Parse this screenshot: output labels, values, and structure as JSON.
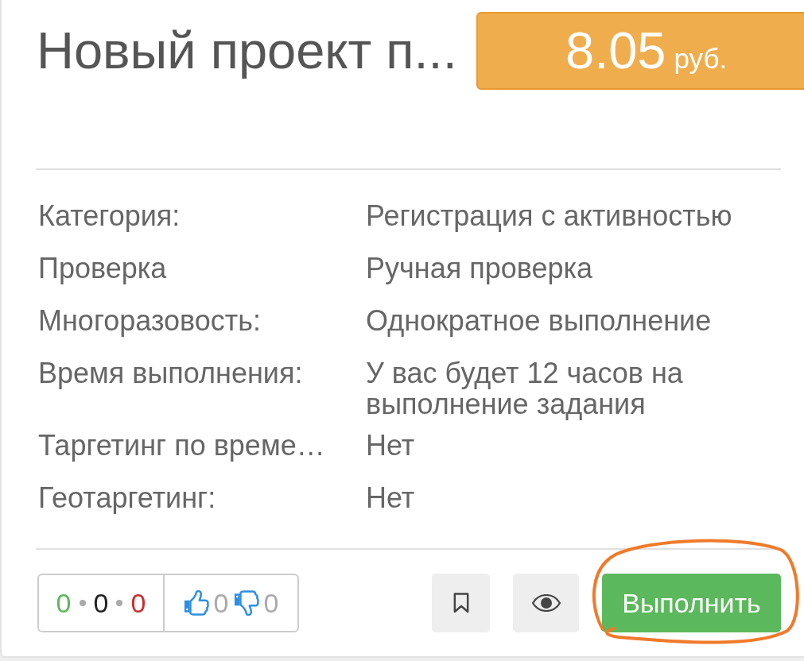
{
  "task": {
    "title": "Новый проект п...",
    "price": {
      "amount": "8.05",
      "currency": "руб."
    }
  },
  "details": [
    {
      "label": "Категория:",
      "value": "Регистрация с активностью"
    },
    {
      "label": "Проверка",
      "value": "Ручная проверка"
    },
    {
      "label": "Многоразовость:",
      "value": "Однократное выполнение"
    },
    {
      "label": "Время выполнения:",
      "value": "У вас будет 12 часов на выполнение задания"
    },
    {
      "label": "Таргетинг по време…",
      "value": "Нет"
    },
    {
      "label": "Геотаргетинг:",
      "value": "Нет"
    }
  ],
  "footer": {
    "stats": [
      {
        "kind": "positive",
        "text": "0"
      },
      {
        "kind": "neutral",
        "text": "0"
      },
      {
        "kind": "negative",
        "text": "0"
      }
    ],
    "votes": {
      "likes": "0",
      "dislikes": "0"
    },
    "buttons": [
      {
        "kind": "bookmark"
      },
      {
        "kind": "view"
      },
      {
        "kind": "primary",
        "label": "Выполнить"
      }
    ]
  },
  "highlight": {
    "kind": "freehand-ellipse"
  }
}
